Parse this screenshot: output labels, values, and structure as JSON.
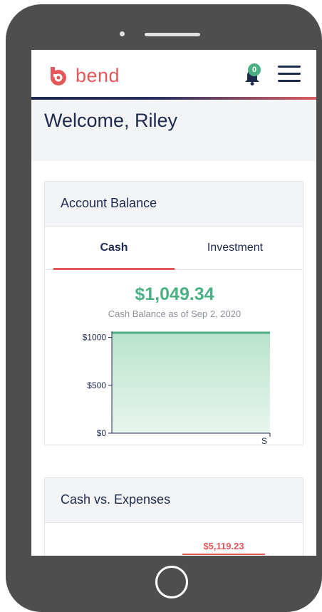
{
  "brand": {
    "name": "bend"
  },
  "notifications": {
    "count": "0"
  },
  "welcome": {
    "text": "Welcome, Riley"
  },
  "account_balance": {
    "title": "Account Balance",
    "tabs": [
      {
        "label": "Cash",
        "active": true
      },
      {
        "label": "Investment",
        "active": false
      }
    ],
    "amount": "$1,049.34",
    "subtitle": "Cash Balance as of Sep 2, 2020"
  },
  "chart_data": {
    "type": "area",
    "x": [
      "S_start",
      "S"
    ],
    "x_tick_labels": [
      "",
      "S"
    ],
    "values": [
      1049.34,
      1049.34
    ],
    "y_ticks": [
      "$1000",
      "$500",
      "$0"
    ],
    "y_tick_values": [
      1000,
      500,
      0
    ],
    "ylim": [
      0,
      1049.34
    ],
    "grid": false
  },
  "cash_vs_expenses": {
    "title": "Cash vs. Expenses",
    "amount": "$5,119.23"
  },
  "colors": {
    "accent": "#e4575a",
    "positive": "#4caf84",
    "navy": "#1f2a4f"
  }
}
